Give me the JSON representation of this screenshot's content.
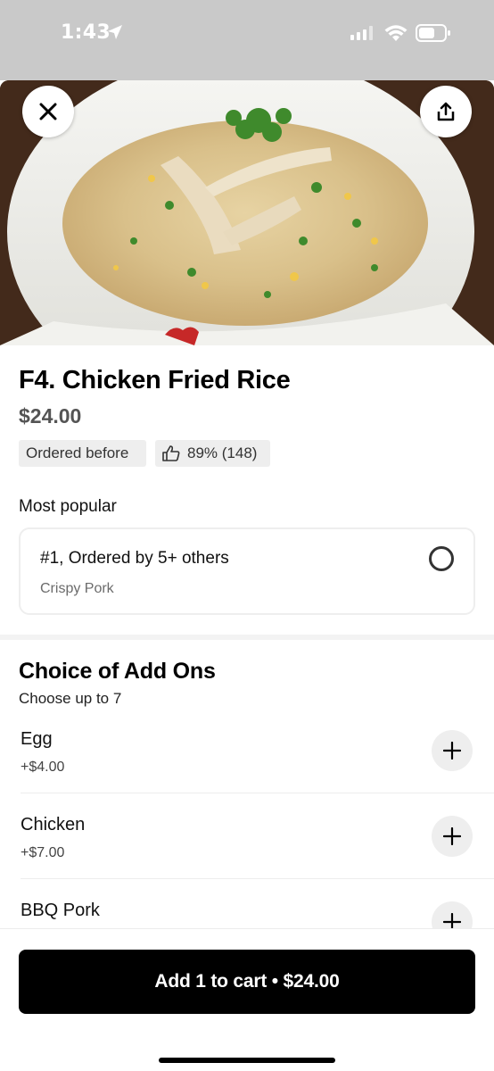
{
  "status_bar": {
    "time": "1:43",
    "icons": [
      "location-arrow-icon",
      "cellular-signal-icon",
      "wifi-icon",
      "battery-icon"
    ]
  },
  "header": {
    "close_icon": "close-icon",
    "share_icon": "share-icon"
  },
  "item": {
    "title": "F4. Chicken Fried Rice",
    "price": "$24.00",
    "badges": {
      "ordered_before": "Ordered before",
      "rating": "89% (148)"
    }
  },
  "most_popular": {
    "label": "Most popular",
    "option_name": "#1, Ordered by 5+ others",
    "option_detail": "Crispy Pork"
  },
  "add_ons": {
    "title": "Choice of Add Ons",
    "subtitle": "Choose up to 7",
    "items": [
      {
        "name": "Egg",
        "price": "+$4.00"
      },
      {
        "name": "Chicken",
        "price": "+$7.00"
      },
      {
        "name": "BBQ Pork",
        "price": ""
      }
    ]
  },
  "cart": {
    "button_label": "Add 1 to cart • $24.00"
  },
  "colors": {
    "status_bar_bg": "#c9c9c9",
    "primary_button": "#000000",
    "chip_bg": "#eeeeee",
    "price_text": "#545454"
  }
}
